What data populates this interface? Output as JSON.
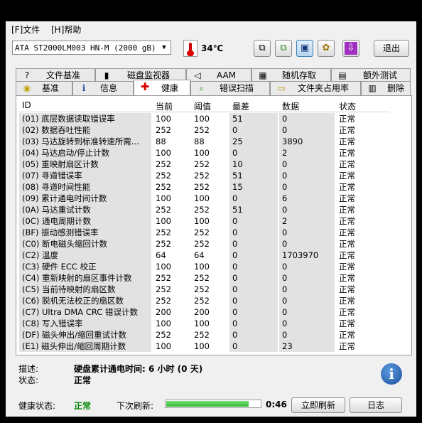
{
  "menu": {
    "file": "[F]文件",
    "help": "[H]帮助"
  },
  "toolbar": {
    "drive": "ATA     ST2000LM003 HN-M (2000 gB)",
    "temperature": "34℃",
    "exit_label": "退出",
    "icons": [
      "copy-icon",
      "copy-all-icon",
      "save-icon",
      "options-icon",
      "download-icon"
    ]
  },
  "tabs_top": [
    {
      "label": "文件基准",
      "icon": "?"
    },
    {
      "label": "磁盘监视器",
      "icon": "▮"
    },
    {
      "label": "AAM",
      "icon": "◁"
    },
    {
      "label": "随机存取",
      "icon": "▦"
    },
    {
      "label": "额外测试",
      "icon": "▤"
    }
  ],
  "tabs_bottom": [
    {
      "label": "基准",
      "icon": "◉"
    },
    {
      "label": "信息",
      "icon": "i"
    },
    {
      "label": "健康",
      "icon": "✚"
    },
    {
      "label": "错误扫描",
      "icon": "⌕"
    },
    {
      "label": "文件夹占用率",
      "icon": "▭"
    },
    {
      "label": "删除",
      "icon": "▥"
    }
  ],
  "table": {
    "headers": {
      "id": "ID",
      "current": "当前",
      "threshold": "阈值",
      "worst": "最差",
      "data": "数据",
      "status": "状态"
    },
    "rows": [
      {
        "id": "(01) 底层数据读取错误率",
        "cur": "100",
        "thr": "100",
        "worst": "51",
        "data": "0",
        "status": "正常"
      },
      {
        "id": "(02) 数据吞吐性能",
        "cur": "252",
        "thr": "252",
        "worst": "0",
        "data": "0",
        "status": "正常"
      },
      {
        "id": "(03) 马达旋转到标准转速所需...",
        "cur": "88",
        "thr": "88",
        "worst": "25",
        "data": "3890",
        "status": "正常"
      },
      {
        "id": "(04) 马达启动/停止计数",
        "cur": "100",
        "thr": "100",
        "worst": "0",
        "data": "2",
        "status": "正常"
      },
      {
        "id": "(05) 重映射扇区计数",
        "cur": "252",
        "thr": "252",
        "worst": "10",
        "data": "0",
        "status": "正常"
      },
      {
        "id": "(07) 寻道错误率",
        "cur": "252",
        "thr": "252",
        "worst": "51",
        "data": "0",
        "status": "正常"
      },
      {
        "id": "(08) 寻道时间性能",
        "cur": "252",
        "thr": "252",
        "worst": "15",
        "data": "0",
        "status": "正常"
      },
      {
        "id": "(09) 累计通电时间计数",
        "cur": "100",
        "thr": "100",
        "worst": "0",
        "data": "6",
        "status": "正常"
      },
      {
        "id": "(0A) 马达重试计数",
        "cur": "252",
        "thr": "252",
        "worst": "51",
        "data": "0",
        "status": "正常"
      },
      {
        "id": "(0C) 通电周期计数",
        "cur": "100",
        "thr": "100",
        "worst": "0",
        "data": "2",
        "status": "正常"
      },
      {
        "id": "(BF) 振动感测错误率",
        "cur": "252",
        "thr": "252",
        "worst": "0",
        "data": "0",
        "status": "正常"
      },
      {
        "id": "(C0) 断电磁头缩回计数",
        "cur": "252",
        "thr": "252",
        "worst": "0",
        "data": "0",
        "status": "正常"
      },
      {
        "id": "(C2) 温度",
        "cur": "64",
        "thr": "64",
        "worst": "0",
        "data": "1703970",
        "status": "正常"
      },
      {
        "id": "(C3) 硬件 ECC 校正",
        "cur": "100",
        "thr": "100",
        "worst": "0",
        "data": "0",
        "status": "正常"
      },
      {
        "id": "(C4) 重新映射的扇区事件计数",
        "cur": "252",
        "thr": "252",
        "worst": "0",
        "data": "0",
        "status": "正常"
      },
      {
        "id": "(C5) 当前待映射的扇区数",
        "cur": "252",
        "thr": "252",
        "worst": "0",
        "data": "0",
        "status": "正常"
      },
      {
        "id": "(C6) 脱机无法校正的扇区数",
        "cur": "252",
        "thr": "252",
        "worst": "0",
        "data": "0",
        "status": "正常"
      },
      {
        "id": "(C7) Ultra DMA CRC 错误计数",
        "cur": "200",
        "thr": "200",
        "worst": "0",
        "data": "0",
        "status": "正常"
      },
      {
        "id": "(C8) 写入错误率",
        "cur": "100",
        "thr": "100",
        "worst": "0",
        "data": "0",
        "status": "正常"
      },
      {
        "id": "(DF) 磁头伸出/缩回重试计数",
        "cur": "252",
        "thr": "252",
        "worst": "0",
        "data": "0",
        "status": "正常"
      },
      {
        "id": "(E1) 磁头伸出/缩回周期计数",
        "cur": "100",
        "thr": "100",
        "worst": "0",
        "data": "23",
        "status": "正常"
      }
    ]
  },
  "description": {
    "desc_label": "描述:",
    "desc_value": "硬盘累计通电时间: 6 小时 (0 天)",
    "status_label": "状态:",
    "status_value": "正常"
  },
  "statusbar": {
    "health_label": "健康状态:",
    "health_value": "正常",
    "health_color": "#0a8a0a",
    "next_refresh_label": "下次刷新:",
    "progress": 0.88,
    "countdown": "0:46",
    "refresh_button": "立即刷新",
    "log_button": "日志"
  }
}
